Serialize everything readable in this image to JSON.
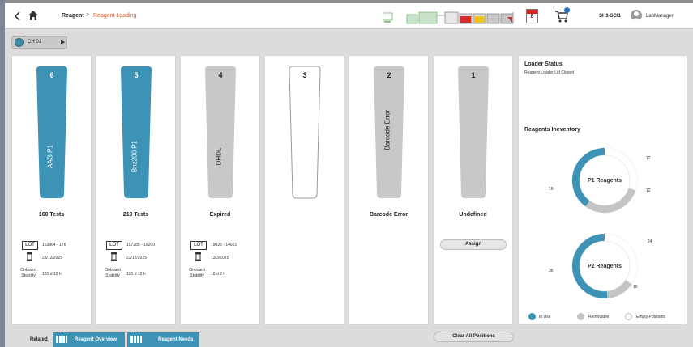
{
  "header": {
    "breadcrumb_parent": "Reagent",
    "breadcrumb_separator": ">",
    "breadcrumb_current": "Reagent Loading",
    "calendar_day": "8",
    "system_name": "SH1-SCI1",
    "user_name": "LabManager",
    "back_icon": "back-chevron-icon",
    "home_icon": "home-icon",
    "cart_icon": "shopping-cart-icon"
  },
  "channel": {
    "label": "CH 01",
    "icon": "channel-globe-icon"
  },
  "positions": [
    {
      "number": "6",
      "name": "AAG P1",
      "status": "160 Tests",
      "state": "loaded",
      "lot_tag": "LOT",
      "lot_range": "153964 - 176",
      "expiry": "23/12/2025",
      "onboard_label": "Onboard Stability",
      "onboard_value": "120 d 12 h"
    },
    {
      "number": "5",
      "name": "Bnz200 P1",
      "status": "210 Tests",
      "state": "loaded",
      "lot_tag": "LOT",
      "lot_range": "157285 - 19200",
      "expiry": "23/12/2025",
      "onboard_label": "Onboard Stability",
      "onboard_value": "120 d 12 h"
    },
    {
      "number": "4",
      "name": "DHDL",
      "status": "Expired",
      "state": "expired",
      "lot_tag": "LOT",
      "lot_range": "19025 - 14661",
      "expiry": "13/3/2025",
      "onboard_label": "Onboard Stability",
      "onboard_value": "10 d 2 h"
    },
    {
      "number": "3",
      "name": "",
      "status": "",
      "state": "empty"
    },
    {
      "number": "2",
      "name": "Barcode Error",
      "status": "Barcode Error",
      "state": "error"
    },
    {
      "number": "1",
      "name": "",
      "status": "Undefined",
      "state": "undefined",
      "assign_label": "Assign"
    }
  ],
  "loader_status": {
    "title": "Loader Status",
    "text": "Reagent Loader Lid Closed"
  },
  "inventory": {
    "title": "Reagents Ineventory",
    "donuts": [
      {
        "center_label": "P1 Reagents",
        "in_use": 16,
        "removable": 12,
        "empty": 12
      },
      {
        "center_label": "P2 Reagents",
        "in_use": 36,
        "removable": 10,
        "empty": 24
      }
    ],
    "legend": [
      {
        "label": "In Use",
        "color": "#3d93b6"
      },
      {
        "label": "Removable",
        "color": "#c4c4c4"
      },
      {
        "label": "Empty Positions",
        "color": "#ffffff"
      }
    ]
  },
  "bottom": {
    "related_label": "Related",
    "reagent_overview_label": "Reagent Overview",
    "reagent_needs_label": "Reagent Needs",
    "clear_all_label": "Clear All Positions"
  },
  "colors": {
    "accent": "#3d93b6",
    "breadcrumb_active": "#e2562a",
    "bottle_gray": "#c8c8c8"
  }
}
